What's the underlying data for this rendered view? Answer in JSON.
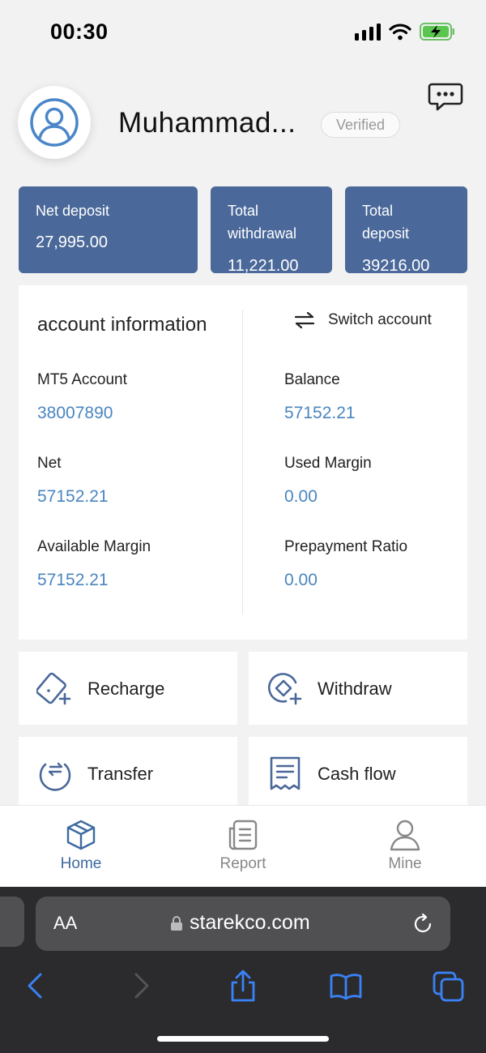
{
  "status_bar": {
    "time": "00:30"
  },
  "profile": {
    "username": "Muhammad...",
    "verified_label": "Verified"
  },
  "summary": {
    "net_deposit": {
      "label": "Net deposit",
      "value": "27,995.00"
    },
    "total_withdrawal": {
      "label_line1": "Total",
      "label_line2": "withdrawal",
      "value": "11,221.00"
    },
    "total_deposit": {
      "label_line1": "Total",
      "label_line2": "deposit",
      "value": "39216.00"
    }
  },
  "account_info": {
    "title": "account information",
    "switch_label": "Switch account",
    "fields": {
      "mt5_account": {
        "label": "MT5 Account",
        "value": "38007890"
      },
      "balance": {
        "label": "Balance",
        "value": "57152.21"
      },
      "net": {
        "label": "Net",
        "value": "57152.21"
      },
      "used_margin": {
        "label": "Used Margin",
        "value": "0.00"
      },
      "available_margin": {
        "label": "Available Margin",
        "value": "57152.21"
      },
      "prepayment_ratio": {
        "label": "Prepayment Ratio",
        "value": "0.00"
      }
    }
  },
  "actions": {
    "recharge": "Recharge",
    "withdraw": "Withdraw",
    "transfer": "Transfer",
    "cash_flow": "Cash flow"
  },
  "tabs": {
    "home": "Home",
    "report": "Report",
    "mine": "Mine"
  },
  "browser": {
    "aa_label": "AA",
    "url": "starekco.com"
  },
  "colors": {
    "card_bg": "#4a6899",
    "value_blue": "#4a86bf",
    "active_tab": "#3d6aa0",
    "icon_blue": "#4a6899",
    "browser_blue": "#3a82f7"
  }
}
